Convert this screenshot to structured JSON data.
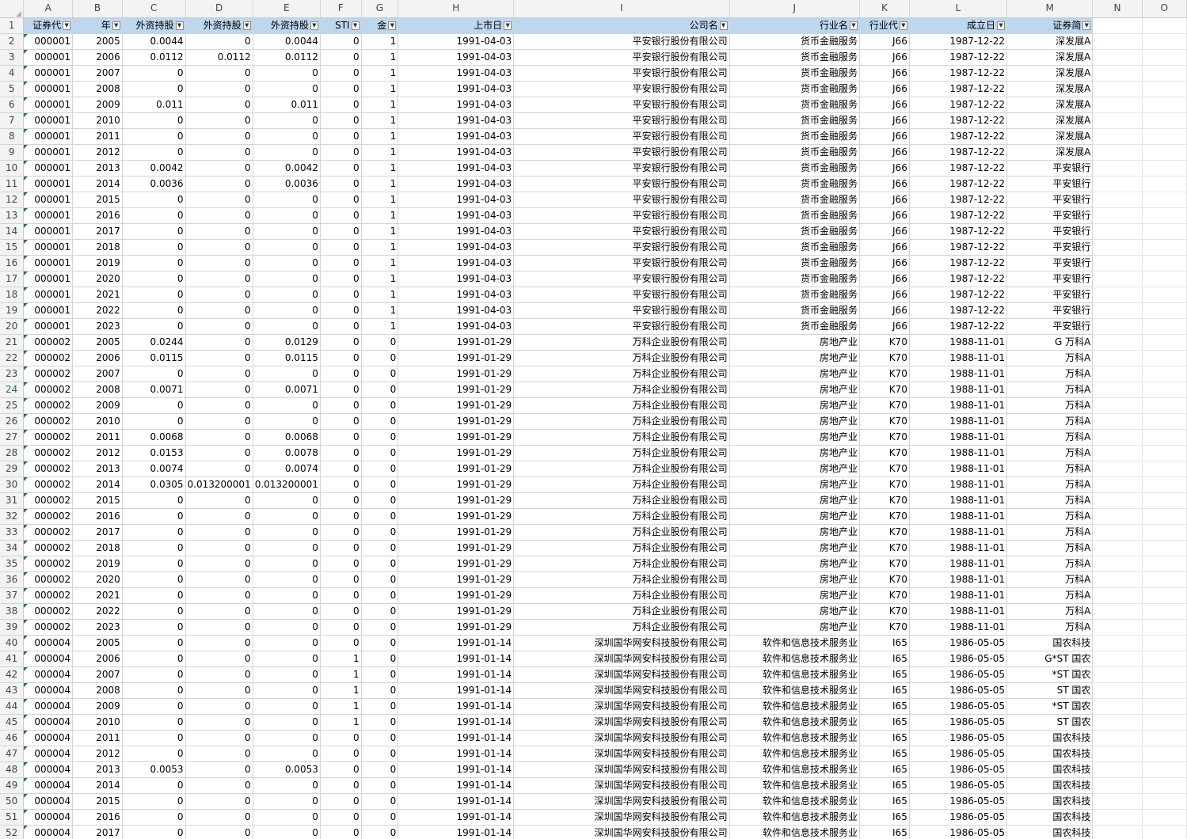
{
  "column_letters": [
    "A",
    "B",
    "C",
    "D",
    "E",
    "F",
    "G",
    "H",
    "I",
    "J",
    "K",
    "L",
    "M",
    "N",
    "O"
  ],
  "headers": [
    "证券代",
    "年",
    "外资持股",
    "外资持股",
    "外资持股",
    "STI",
    "金",
    "上市日",
    "公司名",
    "行业名",
    "行业代",
    "成立日",
    "证券简"
  ],
  "filter_icon": "▼",
  "rows": [
    [
      "000001",
      "2005",
      "0.0044",
      "0",
      "0.0044",
      "0",
      "1",
      "1991-04-03",
      "平安银行股份有限公司",
      "货币金融服务",
      "J66",
      "1987-12-22",
      "深发展A"
    ],
    [
      "000001",
      "2006",
      "0.0112",
      "0.0112",
      "0.0112",
      "0",
      "1",
      "1991-04-03",
      "平安银行股份有限公司",
      "货币金融服务",
      "J66",
      "1987-12-22",
      "深发展A"
    ],
    [
      "000001",
      "2007",
      "0",
      "0",
      "0",
      "0",
      "1",
      "1991-04-03",
      "平安银行股份有限公司",
      "货币金融服务",
      "J66",
      "1987-12-22",
      "深发展A"
    ],
    [
      "000001",
      "2008",
      "0",
      "0",
      "0",
      "0",
      "1",
      "1991-04-03",
      "平安银行股份有限公司",
      "货币金融服务",
      "J66",
      "1987-12-22",
      "深发展A"
    ],
    [
      "000001",
      "2009",
      "0.011",
      "0",
      "0.011",
      "0",
      "1",
      "1991-04-03",
      "平安银行股份有限公司",
      "货币金融服务",
      "J66",
      "1987-12-22",
      "深发展A"
    ],
    [
      "000001",
      "2010",
      "0",
      "0",
      "0",
      "0",
      "1",
      "1991-04-03",
      "平安银行股份有限公司",
      "货币金融服务",
      "J66",
      "1987-12-22",
      "深发展A"
    ],
    [
      "000001",
      "2011",
      "0",
      "0",
      "0",
      "0",
      "1",
      "1991-04-03",
      "平安银行股份有限公司",
      "货币金融服务",
      "J66",
      "1987-12-22",
      "深发展A"
    ],
    [
      "000001",
      "2012",
      "0",
      "0",
      "0",
      "0",
      "1",
      "1991-04-03",
      "平安银行股份有限公司",
      "货币金融服务",
      "J66",
      "1987-12-22",
      "深发展A"
    ],
    [
      "000001",
      "2013",
      "0.0042",
      "0",
      "0.0042",
      "0",
      "1",
      "1991-04-03",
      "平安银行股份有限公司",
      "货币金融服务",
      "J66",
      "1987-12-22",
      "平安银行"
    ],
    [
      "000001",
      "2014",
      "0.0036",
      "0",
      "0.0036",
      "0",
      "1",
      "1991-04-03",
      "平安银行股份有限公司",
      "货币金融服务",
      "J66",
      "1987-12-22",
      "平安银行"
    ],
    [
      "000001",
      "2015",
      "0",
      "0",
      "0",
      "0",
      "1",
      "1991-04-03",
      "平安银行股份有限公司",
      "货币金融服务",
      "J66",
      "1987-12-22",
      "平安银行"
    ],
    [
      "000001",
      "2016",
      "0",
      "0",
      "0",
      "0",
      "1",
      "1991-04-03",
      "平安银行股份有限公司",
      "货币金融服务",
      "J66",
      "1987-12-22",
      "平安银行"
    ],
    [
      "000001",
      "2017",
      "0",
      "0",
      "0",
      "0",
      "1",
      "1991-04-03",
      "平安银行股份有限公司",
      "货币金融服务",
      "J66",
      "1987-12-22",
      "平安银行"
    ],
    [
      "000001",
      "2018",
      "0",
      "0",
      "0",
      "0",
      "1",
      "1991-04-03",
      "平安银行股份有限公司",
      "货币金融服务",
      "J66",
      "1987-12-22",
      "平安银行"
    ],
    [
      "000001",
      "2019",
      "0",
      "0",
      "0",
      "0",
      "1",
      "1991-04-03",
      "平安银行股份有限公司",
      "货币金融服务",
      "J66",
      "1987-12-22",
      "平安银行"
    ],
    [
      "000001",
      "2020",
      "0",
      "0",
      "0",
      "0",
      "1",
      "1991-04-03",
      "平安银行股份有限公司",
      "货币金融服务",
      "J66",
      "1987-12-22",
      "平安银行"
    ],
    [
      "000001",
      "2021",
      "0",
      "0",
      "0",
      "0",
      "1",
      "1991-04-03",
      "平安银行股份有限公司",
      "货币金融服务",
      "J66",
      "1987-12-22",
      "平安银行"
    ],
    [
      "000001",
      "2022",
      "0",
      "0",
      "0",
      "0",
      "1",
      "1991-04-03",
      "平安银行股份有限公司",
      "货币金融服务",
      "J66",
      "1987-12-22",
      "平安银行"
    ],
    [
      "000001",
      "2023",
      "0",
      "0",
      "0",
      "0",
      "1",
      "1991-04-03",
      "平安银行股份有限公司",
      "货币金融服务",
      "J66",
      "1987-12-22",
      "平安银行"
    ],
    [
      "000002",
      "2005",
      "0.0244",
      "0",
      "0.0129",
      "0",
      "0",
      "1991-01-29",
      "万科企业股份有限公司",
      "房地产业",
      "K70",
      "1988-11-01",
      "G 万科A"
    ],
    [
      "000002",
      "2006",
      "0.0115",
      "0",
      "0.0115",
      "0",
      "0",
      "1991-01-29",
      "万科企业股份有限公司",
      "房地产业",
      "K70",
      "1988-11-01",
      "万科A"
    ],
    [
      "000002",
      "2007",
      "0",
      "0",
      "0",
      "0",
      "0",
      "1991-01-29",
      "万科企业股份有限公司",
      "房地产业",
      "K70",
      "1988-11-01",
      "万科A"
    ],
    [
      "000002",
      "2008",
      "0.0071",
      "0",
      "0.0071",
      "0",
      "0",
      "1991-01-29",
      "万科企业股份有限公司",
      "房地产业",
      "K70",
      "1988-11-01",
      "万科A"
    ],
    [
      "000002",
      "2009",
      "0",
      "0",
      "0",
      "0",
      "0",
      "1991-01-29",
      "万科企业股份有限公司",
      "房地产业",
      "K70",
      "1988-11-01",
      "万科A"
    ],
    [
      "000002",
      "2010",
      "0",
      "0",
      "0",
      "0",
      "0",
      "1991-01-29",
      "万科企业股份有限公司",
      "房地产业",
      "K70",
      "1988-11-01",
      "万科A"
    ],
    [
      "000002",
      "2011",
      "0.0068",
      "0",
      "0.0068",
      "0",
      "0",
      "1991-01-29",
      "万科企业股份有限公司",
      "房地产业",
      "K70",
      "1988-11-01",
      "万科A"
    ],
    [
      "000002",
      "2012",
      "0.0153",
      "0",
      "0.0078",
      "0",
      "0",
      "1991-01-29",
      "万科企业股份有限公司",
      "房地产业",
      "K70",
      "1988-11-01",
      "万科A"
    ],
    [
      "000002",
      "2013",
      "0.0074",
      "0",
      "0.0074",
      "0",
      "0",
      "1991-01-29",
      "万科企业股份有限公司",
      "房地产业",
      "K70",
      "1988-11-01",
      "万科A"
    ],
    [
      "000002",
      "2014",
      "0.0305",
      "0.013200001",
      "0.013200001",
      "0",
      "0",
      "1991-01-29",
      "万科企业股份有限公司",
      "房地产业",
      "K70",
      "1988-11-01",
      "万科A"
    ],
    [
      "000002",
      "2015",
      "0",
      "0",
      "0",
      "0",
      "0",
      "1991-01-29",
      "万科企业股份有限公司",
      "房地产业",
      "K70",
      "1988-11-01",
      "万科A"
    ],
    [
      "000002",
      "2016",
      "0",
      "0",
      "0",
      "0",
      "0",
      "1991-01-29",
      "万科企业股份有限公司",
      "房地产业",
      "K70",
      "1988-11-01",
      "万科A"
    ],
    [
      "000002",
      "2017",
      "0",
      "0",
      "0",
      "0",
      "0",
      "1991-01-29",
      "万科企业股份有限公司",
      "房地产业",
      "K70",
      "1988-11-01",
      "万科A"
    ],
    [
      "000002",
      "2018",
      "0",
      "0",
      "0",
      "0",
      "0",
      "1991-01-29",
      "万科企业股份有限公司",
      "房地产业",
      "K70",
      "1988-11-01",
      "万科A"
    ],
    [
      "000002",
      "2019",
      "0",
      "0",
      "0",
      "0",
      "0",
      "1991-01-29",
      "万科企业股份有限公司",
      "房地产业",
      "K70",
      "1988-11-01",
      "万科A"
    ],
    [
      "000002",
      "2020",
      "0",
      "0",
      "0",
      "0",
      "0",
      "1991-01-29",
      "万科企业股份有限公司",
      "房地产业",
      "K70",
      "1988-11-01",
      "万科A"
    ],
    [
      "000002",
      "2021",
      "0",
      "0",
      "0",
      "0",
      "0",
      "1991-01-29",
      "万科企业股份有限公司",
      "房地产业",
      "K70",
      "1988-11-01",
      "万科A"
    ],
    [
      "000002",
      "2022",
      "0",
      "0",
      "0",
      "0",
      "0",
      "1991-01-29",
      "万科企业股份有限公司",
      "房地产业",
      "K70",
      "1988-11-01",
      "万科A"
    ],
    [
      "000002",
      "2023",
      "0",
      "0",
      "0",
      "0",
      "0",
      "1991-01-29",
      "万科企业股份有限公司",
      "房地产业",
      "K70",
      "1988-11-01",
      "万科A"
    ],
    [
      "000004",
      "2005",
      "0",
      "0",
      "0",
      "0",
      "0",
      "1991-01-14",
      "深圳国华网安科技股份有限公司",
      "软件和信息技术服务业",
      "I65",
      "1986-05-05",
      "国农科技"
    ],
    [
      "000004",
      "2006",
      "0",
      "0",
      "0",
      "1",
      "0",
      "1991-01-14",
      "深圳国华网安科技股份有限公司",
      "软件和信息技术服务业",
      "I65",
      "1986-05-05",
      "G*ST 国农"
    ],
    [
      "000004",
      "2007",
      "0",
      "0",
      "0",
      "1",
      "0",
      "1991-01-14",
      "深圳国华网安科技股份有限公司",
      "软件和信息技术服务业",
      "I65",
      "1986-05-05",
      "*ST 国农"
    ],
    [
      "000004",
      "2008",
      "0",
      "0",
      "0",
      "1",
      "0",
      "1991-01-14",
      "深圳国华网安科技股份有限公司",
      "软件和信息技术服务业",
      "I65",
      "1986-05-05",
      "ST 国农"
    ],
    [
      "000004",
      "2009",
      "0",
      "0",
      "0",
      "1",
      "0",
      "1991-01-14",
      "深圳国华网安科技股份有限公司",
      "软件和信息技术服务业",
      "I65",
      "1986-05-05",
      "*ST 国农"
    ],
    [
      "000004",
      "2010",
      "0",
      "0",
      "0",
      "1",
      "0",
      "1991-01-14",
      "深圳国华网安科技股份有限公司",
      "软件和信息技术服务业",
      "I65",
      "1986-05-05",
      "ST 国农"
    ],
    [
      "000004",
      "2011",
      "0",
      "0",
      "0",
      "0",
      "0",
      "1991-01-14",
      "深圳国华网安科技股份有限公司",
      "软件和信息技术服务业",
      "I65",
      "1986-05-05",
      "国农科技"
    ],
    [
      "000004",
      "2012",
      "0",
      "0",
      "0",
      "0",
      "0",
      "1991-01-14",
      "深圳国华网安科技股份有限公司",
      "软件和信息技术服务业",
      "I65",
      "1986-05-05",
      "国农科技"
    ],
    [
      "000004",
      "2013",
      "0.0053",
      "0",
      "0.0053",
      "0",
      "0",
      "1991-01-14",
      "深圳国华网安科技股份有限公司",
      "软件和信息技术服务业",
      "I65",
      "1986-05-05",
      "国农科技"
    ],
    [
      "000004",
      "2014",
      "0",
      "0",
      "0",
      "0",
      "0",
      "1991-01-14",
      "深圳国华网安科技股份有限公司",
      "软件和信息技术服务业",
      "I65",
      "1986-05-05",
      "国农科技"
    ],
    [
      "000004",
      "2015",
      "0",
      "0",
      "0",
      "0",
      "0",
      "1991-01-14",
      "深圳国华网安科技股份有限公司",
      "软件和信息技术服务业",
      "I65",
      "1986-05-05",
      "国农科技"
    ],
    [
      "000004",
      "2016",
      "0",
      "0",
      "0",
      "0",
      "0",
      "1991-01-14",
      "深圳国华网安科技股份有限公司",
      "软件和信息技术服务业",
      "I65",
      "1986-05-05",
      "国农科技"
    ],
    [
      "000004",
      "2017",
      "0",
      "0",
      "0",
      "0",
      "0",
      "1991-01-14",
      "深圳国华网安科技股份有限公司",
      "软件和信息技术服务业",
      "I65",
      "1986-05-05",
      "国农科技"
    ]
  ],
  "active_row": "24"
}
